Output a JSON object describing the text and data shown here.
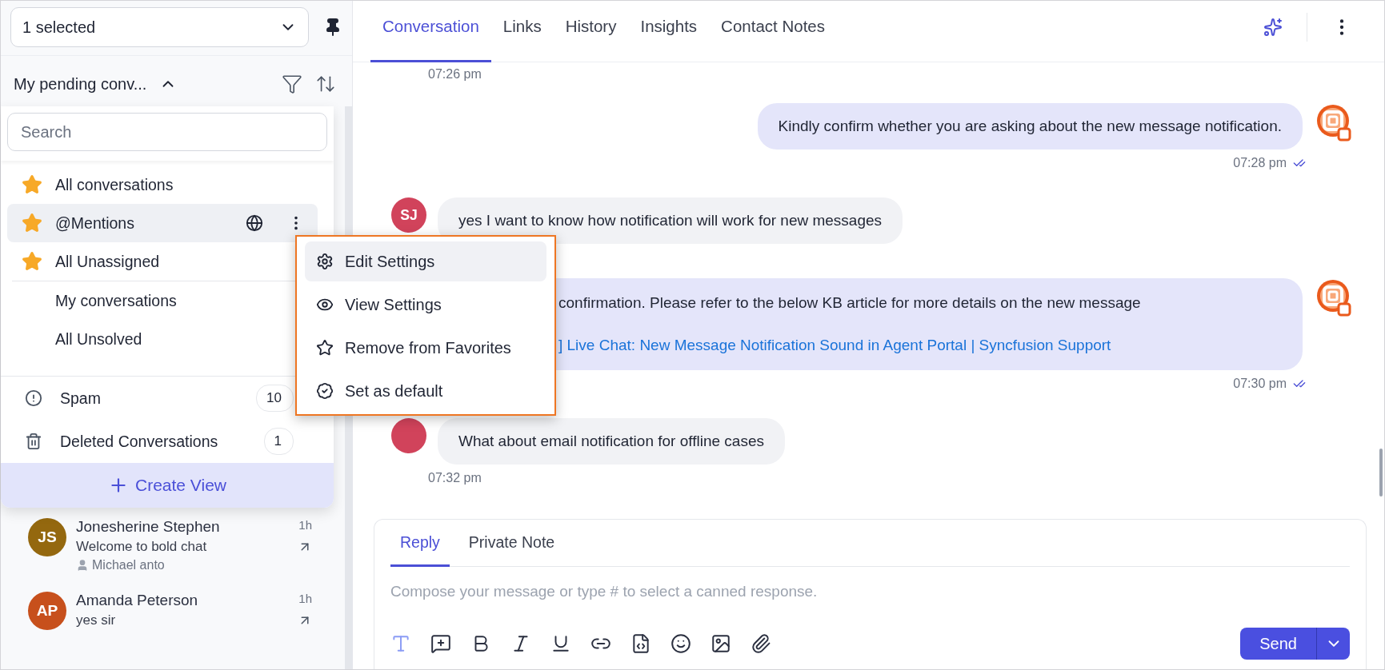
{
  "view_select": {
    "value": "1 selected"
  },
  "list_header": {
    "title": "My pending conv...",
    "expanded": true
  },
  "view_dropdown": {
    "search": {
      "placeholder": "Search"
    },
    "views": [
      {
        "label": "All conversations",
        "favorite": true,
        "selected": false
      },
      {
        "label": "@Mentions",
        "favorite": true,
        "selected": true
      },
      {
        "label": "All Unassigned",
        "favorite": true,
        "selected": false
      },
      {
        "label": "My conversations",
        "favorite": false,
        "selected": false
      },
      {
        "label": "All Unsolved",
        "favorite": false,
        "selected": false
      }
    ],
    "folders": [
      {
        "kind": "spam",
        "label": "Spam",
        "count": "10"
      },
      {
        "kind": "trash",
        "label": "Deleted Conversations",
        "count": "1"
      }
    ],
    "create_button": "Create View"
  },
  "context_menu": [
    {
      "kind": "edit",
      "label": "Edit Settings",
      "selected": true
    },
    {
      "kind": "view",
      "label": "View Settings",
      "selected": false
    },
    {
      "kind": "unfavorite",
      "label": "Remove from Favorites",
      "selected": false
    },
    {
      "kind": "default",
      "label": "Set as default",
      "selected": false
    }
  ],
  "conversations": [
    {
      "initials": "JS",
      "color": "#94680f",
      "name": "Jonesherine Stephen",
      "preview": "Welcome to bold chat",
      "agent": "Michael anto",
      "time": "1h"
    },
    {
      "initials": "AP",
      "color": "#c7501c",
      "name": "Amanda Peterson",
      "preview": "yes sir",
      "time": "1h"
    }
  ],
  "tabs": [
    {
      "label": "Conversation",
      "selected": true
    },
    {
      "label": "Links",
      "selected": false
    },
    {
      "label": "History",
      "selected": false
    },
    {
      "label": "Insights",
      "selected": false
    },
    {
      "label": "Contact Notes",
      "selected": false
    }
  ],
  "messages": [
    {
      "kind": "stamp",
      "time": "07:26 pm"
    },
    {
      "kind": "outgoing",
      "text": "Kindly confirm whether you are asking about the new message notification.",
      "time": "07:28 pm",
      "read": true
    },
    {
      "kind": "incoming",
      "initials": "SJ",
      "color": "#d1435b",
      "text": "yes I want to know how notification will work for new messages"
    },
    {
      "kind": "outgoing_partial",
      "text": "confirmation. Please refer to the below KB article for more details on the new message",
      "link": "] Live Chat: New Message Notification Sound in Agent Portal | Syncfusion Support",
      "time": "07:30 pm",
      "read": true
    },
    {
      "kind": "incoming",
      "color": "#d1435b",
      "text": "What about email notification for offline cases",
      "time": "07:32 pm"
    }
  ],
  "composer": {
    "tabs": [
      {
        "label": "Reply",
        "selected": true
      },
      {
        "label": "Private Note",
        "selected": false
      }
    ],
    "placeholder": "Compose your message or type # to select a canned response.",
    "send": "Send"
  }
}
